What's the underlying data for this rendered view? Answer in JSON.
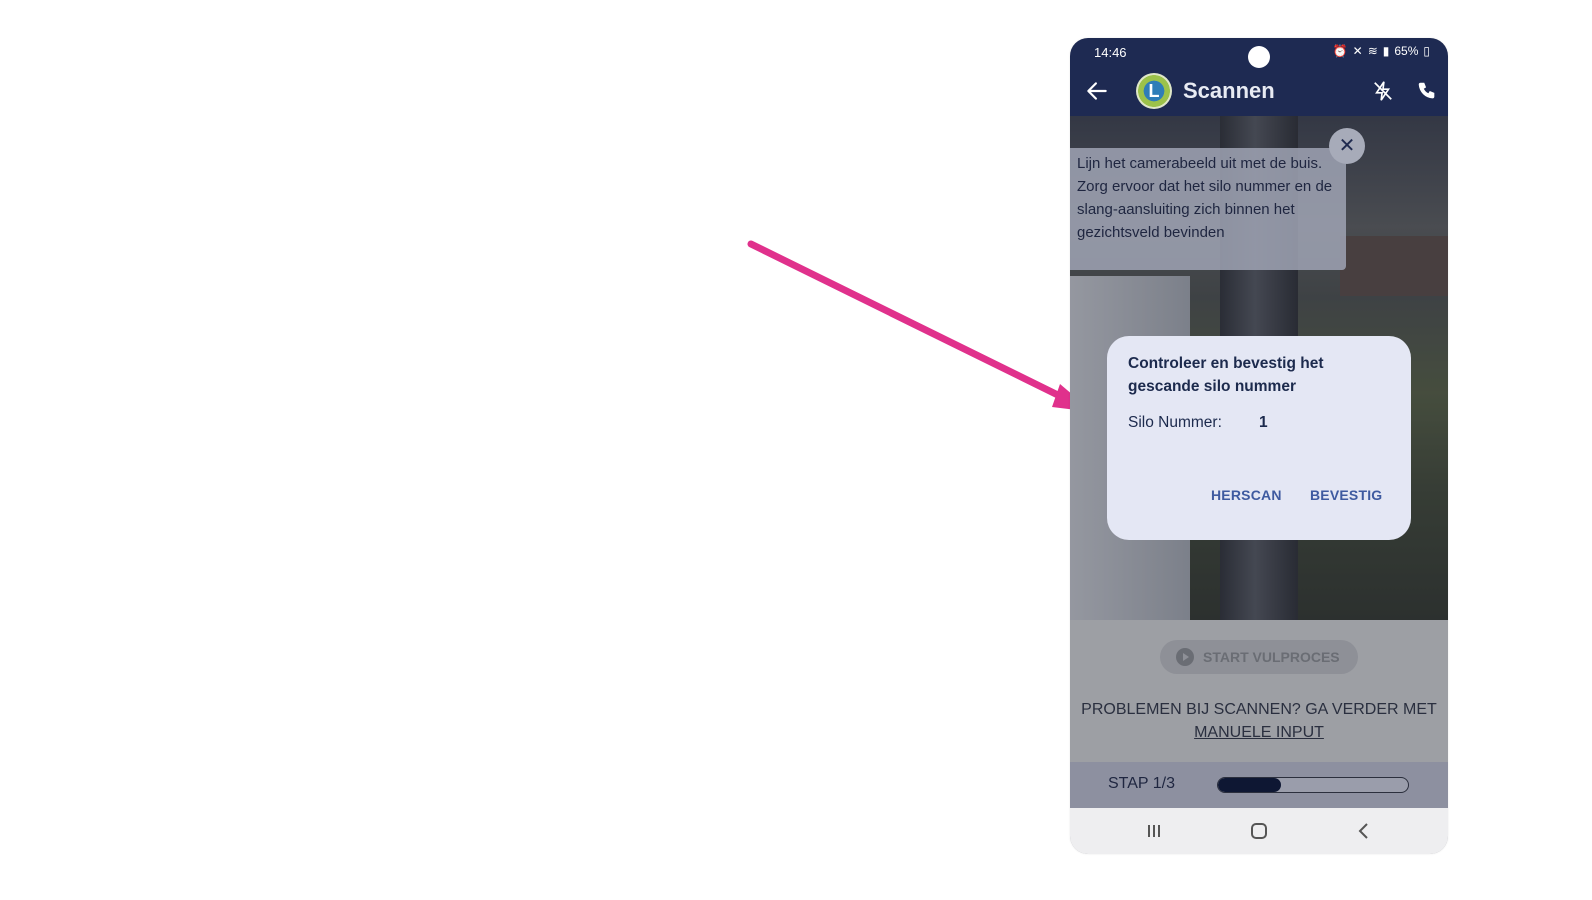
{
  "status_bar": {
    "time": "14:46",
    "battery": "65%"
  },
  "app_bar": {
    "title": "Scannen",
    "logo_letter": "L"
  },
  "hint": {
    "text": "Lijn het camerabeeld uit met de buis. Zorg ervoor dat het silo nummer en de slang-aansluiting zich binnen het gezichtsveld bevinden"
  },
  "dialog": {
    "title": "Controleer en bevestig het gescande silo nummer",
    "label": "Silo Nummer:",
    "value": "1",
    "herscan_label": "HERSCAN",
    "bevestig_label": "BEVESTIG"
  },
  "start_button": {
    "label": "START VULPROCES"
  },
  "problem_text": {
    "prefix": "PROBLEMEN BIJ SCANNEN? GA VERDER MET ",
    "link": "MANUELE INPUT"
  },
  "step": {
    "label": "STAP 1/3",
    "progress_fraction": 0.333
  },
  "colors": {
    "navy": "#1e2a52",
    "accent_arrow": "#e0318c",
    "button_text": "#3e5aa0"
  },
  "icons": [
    "back-arrow-icon",
    "flash-off-icon",
    "phone-icon",
    "close-icon",
    "play-icon",
    "recents-icon",
    "home-icon",
    "back-nav-icon",
    "alarm-icon",
    "mute-icon",
    "wifi-icon",
    "signal-icon",
    "battery-icon"
  ]
}
